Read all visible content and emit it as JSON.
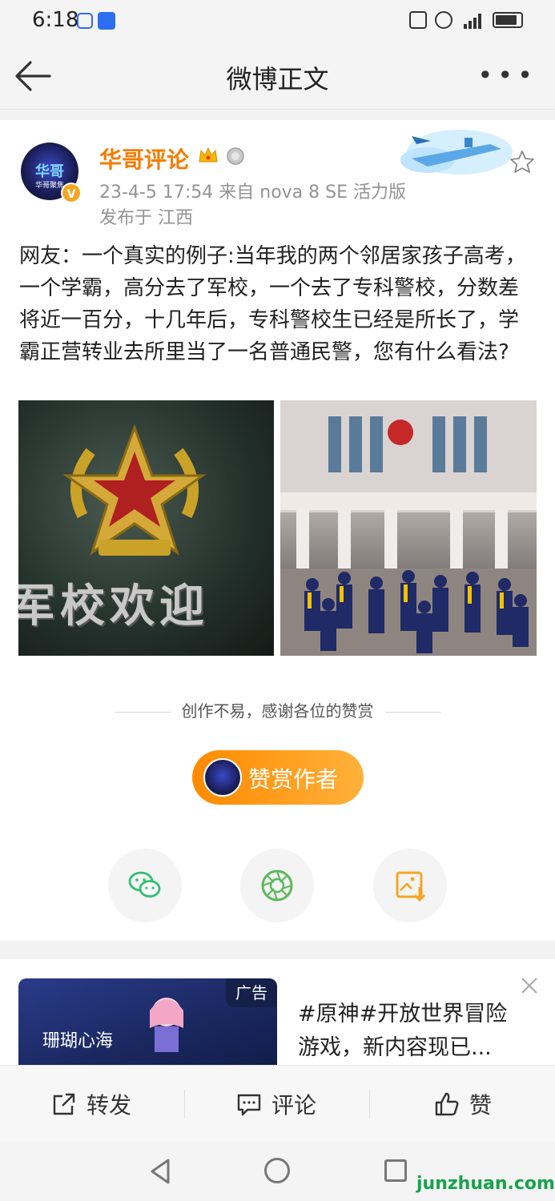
{
  "status_bar": {
    "time": "6:18"
  },
  "header": {
    "title": "微博正文"
  },
  "post": {
    "avatar_text": "华哥",
    "avatar_sub": "华哥聚焦",
    "verified_mark": "V",
    "author": "华哥评论",
    "meta": "23-4-5 17:54  来自 nova 8 SE 活力版",
    "location": "发布于 江西",
    "text": "网友：一个真实的例子:当年我的两个邻居家孩子高考，一个学霸，高分去了军校，一个去了专科警校，分数差将近一百分，十几年后，专科警校生已经是所长了，学霸正营转业去所里当了一名普通民警，您有什么看法?",
    "image1_overlay_text": "军校欢迎",
    "appreciate_note": "创作不易，感谢各位的赞赏",
    "reward_label": "赞赏作者"
  },
  "share": {
    "icons": [
      "wechat-icon",
      "moments-icon",
      "save-image-icon"
    ]
  },
  "ad": {
    "tag": "广告",
    "image_text": "珊瑚心海",
    "text": "#原神#开放世界冒险游戏，新内容现已..."
  },
  "actions": {
    "repost": "转发",
    "comment": "评论",
    "like": "赞"
  },
  "watermark": "junzhuan.com",
  "colors": {
    "username": "#f57c00",
    "reward_start": "#ff8a00",
    "reward_end": "#ffb13b",
    "wechat_green": "#2fbf71",
    "save_orange": "#f5a623"
  }
}
